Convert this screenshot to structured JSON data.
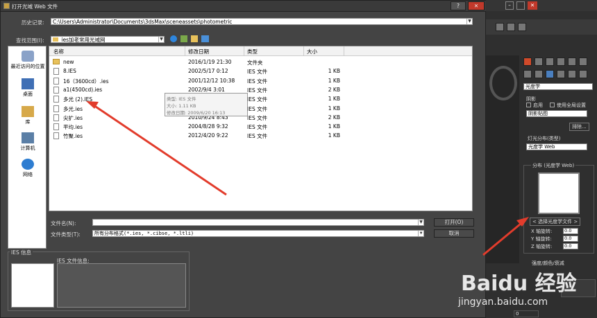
{
  "dialog": {
    "title": "打开光域 Web 文件",
    "history_label": "历史记录:",
    "history_value": "C:\\Users\\Administrator\\Documents\\3dsMax\\sceneassets\\photometric",
    "lookin_label": "查找范围(I):",
    "lookin_value": "ies加老常用光域网",
    "columns": [
      "名称",
      "修改日期",
      "类型",
      "大小"
    ],
    "files": [
      {
        "name": "new",
        "date": "2016/1/19 21:30",
        "type": "文件夹",
        "size": "",
        "folder": true
      },
      {
        "name": "8.IES",
        "date": "2002/5/17 0:12",
        "type": "IES 文件",
        "size": "1 KB"
      },
      {
        "name": "16（3600cd）.ies",
        "date": "2001/12/12 10:38",
        "type": "IES 文件",
        "size": "1 KB"
      },
      {
        "name": "a1(4500cd).ies",
        "date": "2002/9/4 3:01",
        "type": "IES 文件",
        "size": "2 KB"
      },
      {
        "name": "多光 (2).IES",
        "date": "",
        "type": "IES 文件",
        "size": "1 KB"
      },
      {
        "name": "多光.ies",
        "date": "",
        "type": "IES 文件",
        "size": "1 KB"
      },
      {
        "name": "尖扩.ies",
        "date": "2010/9/24 8:43",
        "type": "IES 文件",
        "size": "2 KB"
      },
      {
        "name": "平均.ies",
        "date": "2004/8/28 9:32",
        "type": "IES 文件",
        "size": "1 KB"
      },
      {
        "name": "竹聚.ies",
        "date": "2012/4/20 9:22",
        "type": "IES 文件",
        "size": "1 KB"
      }
    ],
    "tooltip": [
      "类型: IES 文件",
      "大小: 1.11 KB",
      "修改日期: 2009/6/20 16:13"
    ],
    "places": [
      "最近访问的位置",
      "桌面",
      "库",
      "计算机",
      "网络"
    ],
    "filename_label": "文件名(N):",
    "filename_value": "",
    "filetype_label": "文件类型(T):",
    "filetype_value": "所有分布格式(*.ies, *.cibse, *.ltli)",
    "open_button": "打开(O)",
    "cancel_button": "取消",
    "ies_info_group": "IES 信息",
    "ies_file_info_label": "IES 文件信息:"
  },
  "right_panel": {
    "dropdown_1": "光度学",
    "shadow_label": "阴影",
    "enable_label": "启用",
    "global_label": "使用全局设置",
    "shadow_type": "阴影贴图",
    "exclude_button": "排除...",
    "light_dist_label": "灯光分布(类型)",
    "light_dist_value": "光度学 Web",
    "group_title": "分布 (光度学 Web)",
    "choose_file_button": "< 选择光度学文件 >",
    "x_label": "X 轴旋转:",
    "y_label": "Y 轴旋转:",
    "z_label": "Z 轴旋转:",
    "x_value": "0.0",
    "y_value": "0.0",
    "z_value": "0.0",
    "intensity_group": "强度/颜色/衰减",
    "watermark": "Baidu 经验",
    "watermark_url": "jingyan.baidu.com",
    "bottom_value": "0"
  },
  "colors": {
    "accent_arrow": "#e23c2c",
    "dialog_bg": "#444444",
    "folder": "#e8c15b"
  }
}
